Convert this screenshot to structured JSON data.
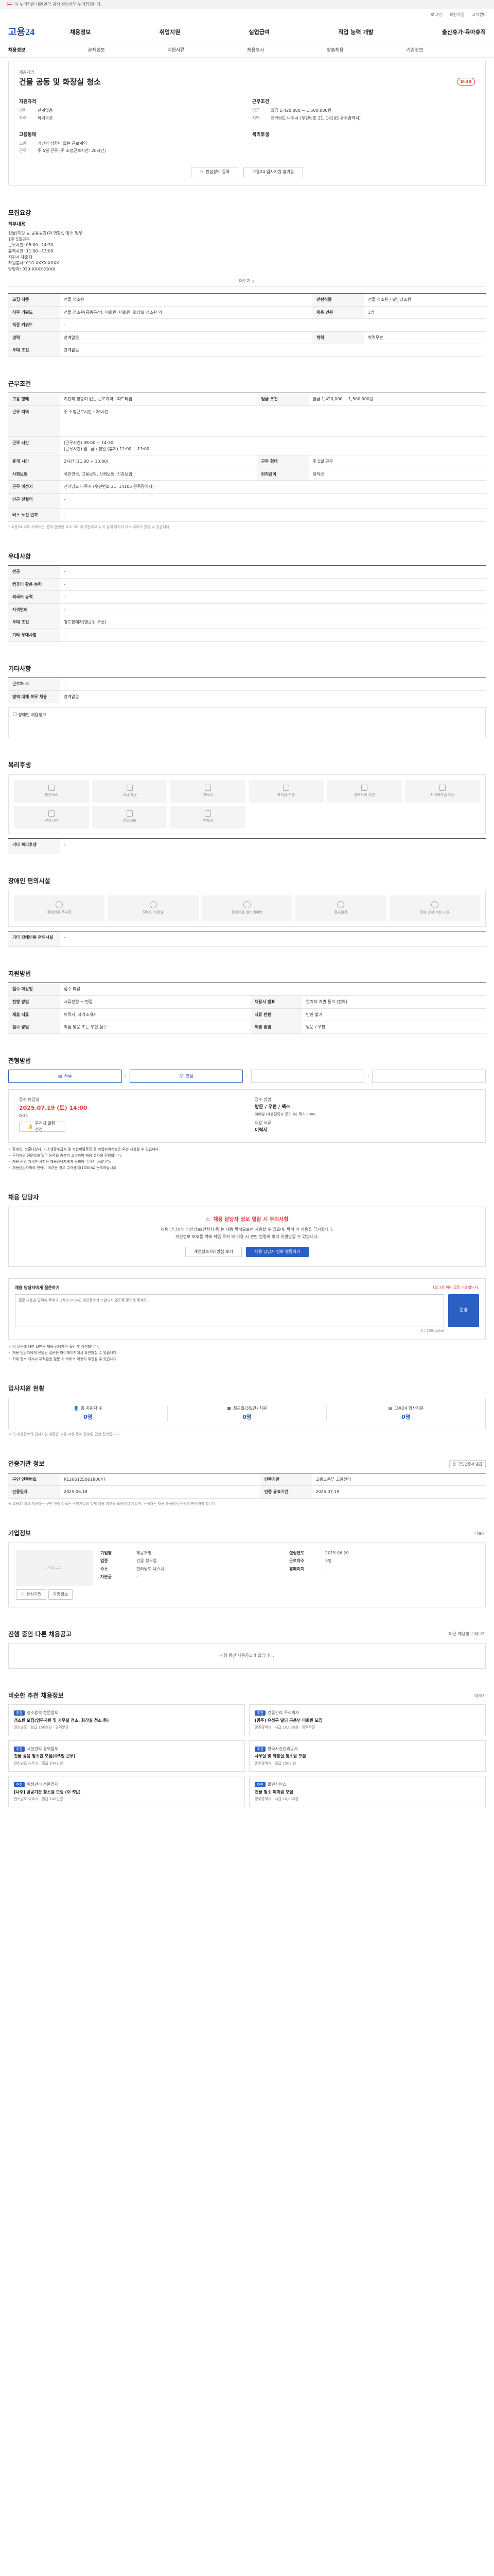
{
  "gov_banner": "이 누리집은 대한민국 공식 전자정부 누리집입니다.",
  "util": [
    "로그인",
    "회원가입",
    "고객센터"
  ],
  "logo": {
    "main": "고용24"
  },
  "gnb": [
    "채용정보",
    "취업지원",
    "실업급여",
    "직업 능력 개발",
    "출산휴가·육아휴직"
  ],
  "lnb": [
    "채용정보",
    "공채정보",
    "지원서류",
    "채용행사",
    "맞춤채용",
    "기업정보"
  ],
  "job": {
    "company_label": "제공처명",
    "title": "건물 공동 및 화장실 청소",
    "dday": "D-30",
    "left_h1": "지원자격",
    "kv1": [
      {
        "k": "경력",
        "v": "관계없음"
      },
      {
        "k": "학력",
        "v": "학력무관"
      }
    ],
    "left_h2": "고용형태",
    "kv2": [
      {
        "k": "고용",
        "v": "기간의 정함이 없는 근로계약"
      },
      {
        "k": "근무",
        "v": "주 5일 근무 (주 소정근로시간: 20시간)"
      }
    ],
    "right_h1": "근무조건",
    "kv3": [
      {
        "k": "임금",
        "v": "월급 1,420,000 ~ 1,500,000원"
      },
      {
        "k": "지역",
        "v": "전라남도 나주시 (우편번호 21, 14105 광주광역시)"
      }
    ],
    "right_h2": "복리후생",
    "btn_interest": "관심정보 등록",
    "btn_print": "고용24 입사지원 불가능"
  },
  "recruit": {
    "title": "모집요강",
    "job_label": "직무내용",
    "job_desc": "건물(계단 등 공용공간)과 화장실 청소 업무\n1주 5일근무\n근무시간: 08:00~14:30\n휴게시간: 11:00~13:00\n지원서 제출처\n자원봉사: 010-XXXX-XXXX\n담당자: 010-XXXX-XXXX",
    "more": "더보기 ∨",
    "rows": [
      {
        "k": "모집 직종",
        "v": "건물 청소원",
        "k2": "관련직종",
        "v2": "건물 청소원 / 빌딩청소원"
      },
      {
        "k": "직무 키워드",
        "v": "건물 청소원(공용공간), 미화원, 미화원, 화장실 청소원 외",
        "k2": "채용 인원",
        "v2": "1명"
      },
      {
        "k": "직종 키워드",
        "v": "-",
        "k2": "",
        "v2": ""
      },
      {
        "k": "경력",
        "v": "관계없음",
        "k2": "학력",
        "v2": "학력무관"
      },
      {
        "k": "우대 조건",
        "v": "관계없음",
        "k2": "",
        "v2": ""
      }
    ]
  },
  "work": {
    "title": "근무조건",
    "rows": [
      {
        "k": "고용 형태",
        "v": "기간의 정함이 없는 근로계약 · 파트타임",
        "k2": "임금 조건",
        "v2": "월급 1,420,000 ~ 1,500,000원"
      },
      {
        "k": "근무 지역",
        "v": "주 소정근로시간 : 20시간",
        "k2": "",
        "v2": ""
      },
      {
        "k": "근무 시간",
        "v": "(근무시간) 08:00 ~ 14:30\n(근무시간) 월~금 / 평일 (휴게) 11:00 ~ 13:00",
        "k2": "",
        "v2": ""
      },
      {
        "k": "휴게 시간",
        "v": "2시간 (11:00 ~ 13:00)",
        "k2": "근무 형태",
        "v2": "주 5일 근무"
      },
      {
        "k": "사회보험",
        "v": "국민연금, 고용보험, 산재보험, 건강보험",
        "k2": "퇴직급여",
        "v2": "퇴직금"
      },
      {
        "k": "근무 예정지",
        "v": "전라남도 나주시 (우편번호 21, 14105 광주광역시)",
        "k2": "",
        "v2": ""
      },
      {
        "k": "인근 전철역",
        "v": "-",
        "k2": "",
        "v2": ""
      },
      {
        "k": "버스 노선 번호",
        "v": "-",
        "k2": "",
        "v2": ""
      }
    ],
    "note": "* 고용24 지도 서비스는 '전국 법정동 주소 DB'에 기반하고 있어 실제 위치와 다소 차이가 있을 수 있습니다."
  },
  "prefer": {
    "title": "우대사항",
    "rows": [
      {
        "k": "전공",
        "v": "-"
      },
      {
        "k": "컴퓨터 활용 능력",
        "v": "-"
      },
      {
        "k": "외국어 능력",
        "v": "-"
      },
      {
        "k": "자격면허",
        "v": "-"
      },
      {
        "k": "우대 조건",
        "v": "경도장애자(영순위 우선)"
      },
      {
        "k": "기타 우대사항",
        "v": "-"
      }
    ]
  },
  "etc": {
    "title": "기타사항",
    "rows": [
      {
        "k": "근로자 수",
        "v": "-"
      },
      {
        "k": "병역 대체 복무 채용",
        "v": "관계없음"
      }
    ],
    "check": "장애인 채용정보"
  },
  "welfare": {
    "title": "복리후생",
    "items": [
      "통근버스",
      "식사 제공",
      "기숙사",
      "학자금 지원",
      "경조사비 지원",
      "자녀학자금 지원",
      "건강검진",
      "명절선물",
      "휴가비",
      "",
      "",
      ""
    ],
    "other_label": "기타 복리후생",
    "other_value": "-"
  },
  "disabled": {
    "title": "장애인 편의시설",
    "items": [
      "장애인용 주차장",
      "장애인 화장실",
      "장애인용 엘리베이터",
      "점자블록",
      "장애 인식 개선 교육"
    ],
    "other_label": "기타 장애인용 편의시설",
    "other_value": "-"
  },
  "apply_cond": {
    "title": "지원방법",
    "rows": [
      {
        "k": "접수 마감일",
        "v": "접수 마감",
        "k2": "",
        "v2": ""
      },
      {
        "k": "전형 방법",
        "v": "서류전형 → 면접",
        "k2": "채용서 발표",
        "v2": "합격자 개별 통보 (전화)"
      },
      {
        "k": "제출 서류",
        "v": "이력서, 자기소개서",
        "k2": "서류 반환",
        "v2": "반환 불가"
      },
      {
        "k": "접수 방법",
        "v": "직접 방문 또는 우편 접수",
        "k2": "제출 방법",
        "v2": "방문 / 우편"
      }
    ]
  },
  "process": {
    "title": "전형방법",
    "steps": [
      "서류",
      "면접",
      "",
      ""
    ]
  },
  "reception": {
    "c1_label": "접수 마감일",
    "c1_value": "2025.07.19 (토) 14:00",
    "c1_sub": "D-30",
    "c1_btn": "구직자 알림 신청",
    "c2_label": "접수 방법",
    "c2_value": "방문 / 우편 / 팩스",
    "c2_sub": "이메일 (채용담당자 문의 후) 팩스 0000",
    "c3_label": "채용 서류",
    "c3_value": "이력서",
    "bullets": [
      "장애인, 보훈대상자, 기초생활수급자 및 북한이탈주민 등 취업취약계층은 우선 채용될 수 있습니다.",
      "구직자의 전문성과 업무 능력을 충분히 고려하여 채용 절차를 진행합니다.",
      "채용 관련 자세한 사항은 채용담당자에게 문의해 주시기 바랍니다.",
      "채용담당자와의 연락이 어려운 경우 고객센터(1350)로 문의하십시오."
    ]
  },
  "manager": {
    "title": "채용 담당자",
    "alert": "채용 담당자 정보 열람 시 주의사항",
    "desc": "채용 담당자의 개인정보(연락처 등)는 채용 목적으로만 사용할 수 있으며, 목적 외 이용을 금지합니다.",
    "desc2": "개인정보 보호를 위해 취업 목적 외 이용 시 관련 법령에 따라 처벌받을 수 있습니다.",
    "btn1": "개인정보처리방침 보기",
    "btn2": "채용 담당자 정보 열람하기",
    "q_label": "채용 담당자에게 질문하기",
    "q_sub": "1일 3회 이내 질문 가능합니다.",
    "q_placeholder": "질문 내용을 입력해 주세요. (최대 500자) 개인정보가 포함되지 않도록 주의해 주세요.",
    "q_count": "0 / 500(byte)",
    "q_send": "전송",
    "bullets": [
      "이 질문에 대한 답변은 채용 담당자가 확인 후 작성합니다.",
      "채용 담당자에게 전달된 질문은 마이페이지에서 확인하실 수 있습니다.",
      "허위 정보 게시나 부적절한 질문 시 서비스 이용이 제한될 수 있습니다."
    ]
  },
  "applicants": {
    "title": "입사지원 현황",
    "stats": [
      {
        "l": "총 지원자 수",
        "n": "0명"
      },
      {
        "l": "최근일(3일간) 지원",
        "n": "0명"
      },
      {
        "l": "고용24 입사지원",
        "n": "0명"
      }
    ],
    "note": "※ 이 채용정보의 입사지원 현황은 고용24를 통해 접수된 건만 집계됩니다."
  },
  "info": {
    "title": "인증기관 정보",
    "btn": "구인인증서 발급",
    "rows": [
      {
        "k": "구인 인증번호",
        "v": "K120612506180047",
        "k2": "인증기관",
        "v2": "고용노동부 고용센터"
      },
      {
        "k": "인증일자",
        "v": "2025.06.18",
        "k2": "인증 유효기간",
        "v2": "2025.07.19"
      }
    ],
    "note": "※ 고용24에서 제공하는 구인 인증 정보는 구인기업의 실제 채용 여부를 보증하지 않으며, 구직자는 채용 과정에서 신중히 판단해야 합니다."
  },
  "company": {
    "title": "기업정보",
    "more": "더보기",
    "logo": "기업 로고",
    "btn1": "관심기업",
    "btn2": "기업정보",
    "rows": [
      {
        "k": "기업명",
        "v": "제공처명",
        "k2": "설립연도",
        "v2": "2015.06.20"
      },
      {
        "k": "업종",
        "v": "건물 청소업",
        "k2": "근로자수",
        "v2": "5명"
      },
      {
        "k": "주소",
        "v": "전라남도 나주시",
        "k2": "홈페이지",
        "v2": "-"
      },
      {
        "k": "자본금",
        "v": "-",
        "k2": "",
        "v2": ""
      }
    ]
  },
  "other": {
    "title": "진행 중인 다른 채용공고",
    "more": "다른 채용정보 더보기",
    "empty": "진행 중인 채용공고가 없습니다."
  },
  "recommend": {
    "title": "비슷한 추천 채용정보",
    "more": "더보기",
    "cards": [
      {
        "tag": "추천",
        "co": "청소용역 전문업체",
        "ti": "청소원 모집(업무지원 및 사무실 청소, 화장실 청소 등)",
        "meta": "전라남도 · 월급 150만원 · 경력무관"
      },
      {
        "tag": "추천",
        "co": "건물관리 주식회사",
        "ti": "[광주] 유성구 빌딩 공용부 미화원 모집",
        "meta": "광주광역시 · 시급 10,030원 · 경력무관"
      },
      {
        "tag": "추천",
        "co": "시설관리 용역업체",
        "ti": "건물 공용 청소원 모집(주5일 근무)",
        "meta": "전라남도 나주시 · 월급 140만원"
      },
      {
        "tag": "추천",
        "co": "한국시설관리공사",
        "ti": "사무실 및 화장실 청소원 모집",
        "meta": "광주광역시 · 월급 150만원"
      },
      {
        "tag": "추천",
        "co": "위생관리 전문업체",
        "ti": "[나주] 공공기관 청소원 모집 (주 5일)",
        "meta": "전라남도 나주시 · 월급 145만원"
      },
      {
        "tag": "추천",
        "co": "클린서비스",
        "ti": "건물 청소 미화원 모집",
        "meta": "광주광역시 · 시급 10,030원"
      }
    ]
  }
}
